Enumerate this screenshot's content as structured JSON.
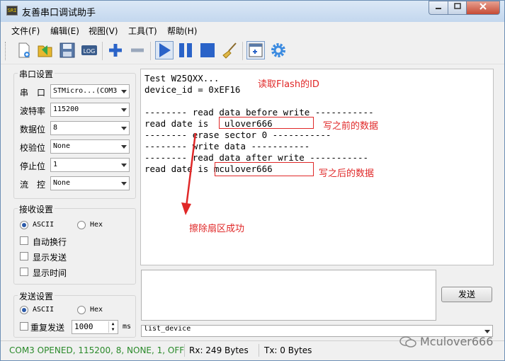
{
  "window": {
    "title": "友善串口调试助手",
    "icon_label": "SRI"
  },
  "menu": [
    "文件(F)",
    "编辑(E)",
    "视图(V)",
    "工具(T)",
    "帮助(H)"
  ],
  "toolbar": {
    "log_label": "LOG",
    "icons": [
      "new-icon",
      "open-icon",
      "save-icon",
      "log-icon",
      "add-icon",
      "remove-icon",
      "play-icon",
      "pause-icon",
      "stop-icon",
      "clear-icon",
      "new-window-icon",
      "settings-icon"
    ]
  },
  "serial": {
    "group_title": "串口设置",
    "port_label": "串　口",
    "port_value": "STMicro...(COM3",
    "baud_label": "波特率",
    "baud_value": "115200",
    "databits_label": "数据位",
    "databits_value": "8",
    "parity_label": "校验位",
    "parity_value": "None",
    "stopbits_label": "停止位",
    "stopbits_value": "1",
    "flow_label": "流　控",
    "flow_value": "None"
  },
  "receive_settings": {
    "group_title": "接收设置",
    "ascii": "ASCII",
    "hex": "Hex",
    "auto_wrap": "自动换行",
    "show_send": "显示发送",
    "show_time": "显示时间"
  },
  "send_settings": {
    "group_title": "发送设置",
    "ascii": "ASCII",
    "hex": "Hex",
    "repeat": "重复发送",
    "interval_value": "1000",
    "interval_unit": "ms"
  },
  "receive_lines": [
    "Test W25QXX...",
    "device_id = 0xEF16",
    "",
    "-------- read data before write -----------",
    "read date is   ulover666",
    "-------- erase sector 0 -----------",
    "-------- write data -----------",
    "-------- read data after write -----------",
    "read date is mculover666"
  ],
  "annotations": {
    "read_id": "读取Flash的ID",
    "before_write": "写之前的数据",
    "after_write": "写之后的数据",
    "erase_ok": "擦除扇区成功"
  },
  "send_button": "发送",
  "device_combo_value": "list_device",
  "status": {
    "port": "COM3 OPENED, 115200, 8, NONE, 1, OFF",
    "rx": "Rx: 249 Bytes",
    "tx": "Tx: 0 Bytes"
  },
  "watermark": "Mculover666",
  "colors": {
    "annotation": "#e02828",
    "status_ok": "#2a8a2a",
    "toolbar_blue": "#2a63c8"
  }
}
